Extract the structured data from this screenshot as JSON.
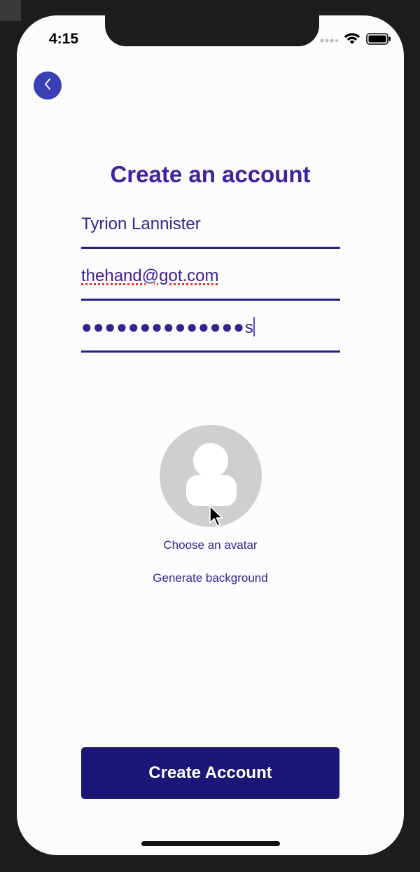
{
  "status_bar": {
    "time": "4:15",
    "icons": [
      "signal-dots-icon",
      "wifi-icon",
      "battery-icon"
    ]
  },
  "nav": {
    "back_icon": "chevron-left-icon"
  },
  "form": {
    "title": "Create an account",
    "name_value": "Tyrion Lannister",
    "email_value": "thehand@got.com",
    "password_masked": "●●●●●●●●●●●●●●",
    "password_last_char": "s"
  },
  "avatar": {
    "icon": "person-placeholder-icon",
    "choose_label": "Choose an avatar",
    "generate_label": "Generate background"
  },
  "actions": {
    "create_label": "Create Account"
  },
  "colors": {
    "primary": "#1b1776",
    "accent": "#3b3fb4",
    "text": "#3a228e",
    "title": "#3f2399",
    "avatar_bg": "#cfcfd1"
  }
}
